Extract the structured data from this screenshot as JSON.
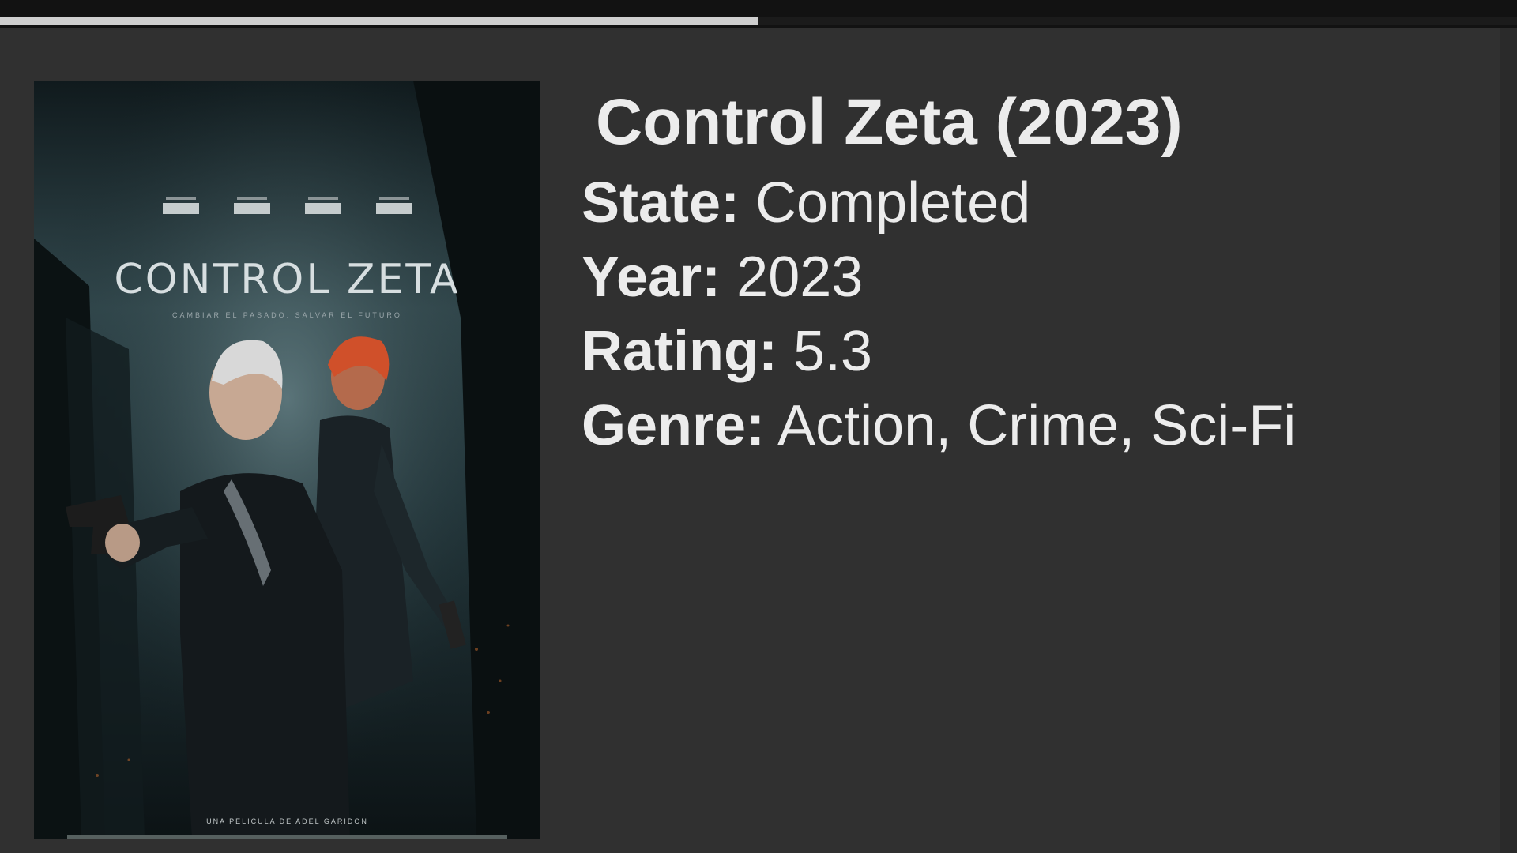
{
  "progress": {
    "fraction": 0.5
  },
  "poster": {
    "title": "CONTROL ZETA",
    "tagline": "CAMBIAR EL PASADO. SALVAR EL FUTURO",
    "director_line": "UNA PELICULA DE ADEL GARIDON"
  },
  "details": {
    "title": "Control Zeta (2023)",
    "fields": [
      {
        "label": "State:",
        "value": "Completed"
      },
      {
        "label": "Year:",
        "value": "2023"
      },
      {
        "label": "Rating:",
        "value": "5.3"
      },
      {
        "label": "Genre:",
        "value": "Action, Crime, Sci-Fi"
      }
    ]
  }
}
